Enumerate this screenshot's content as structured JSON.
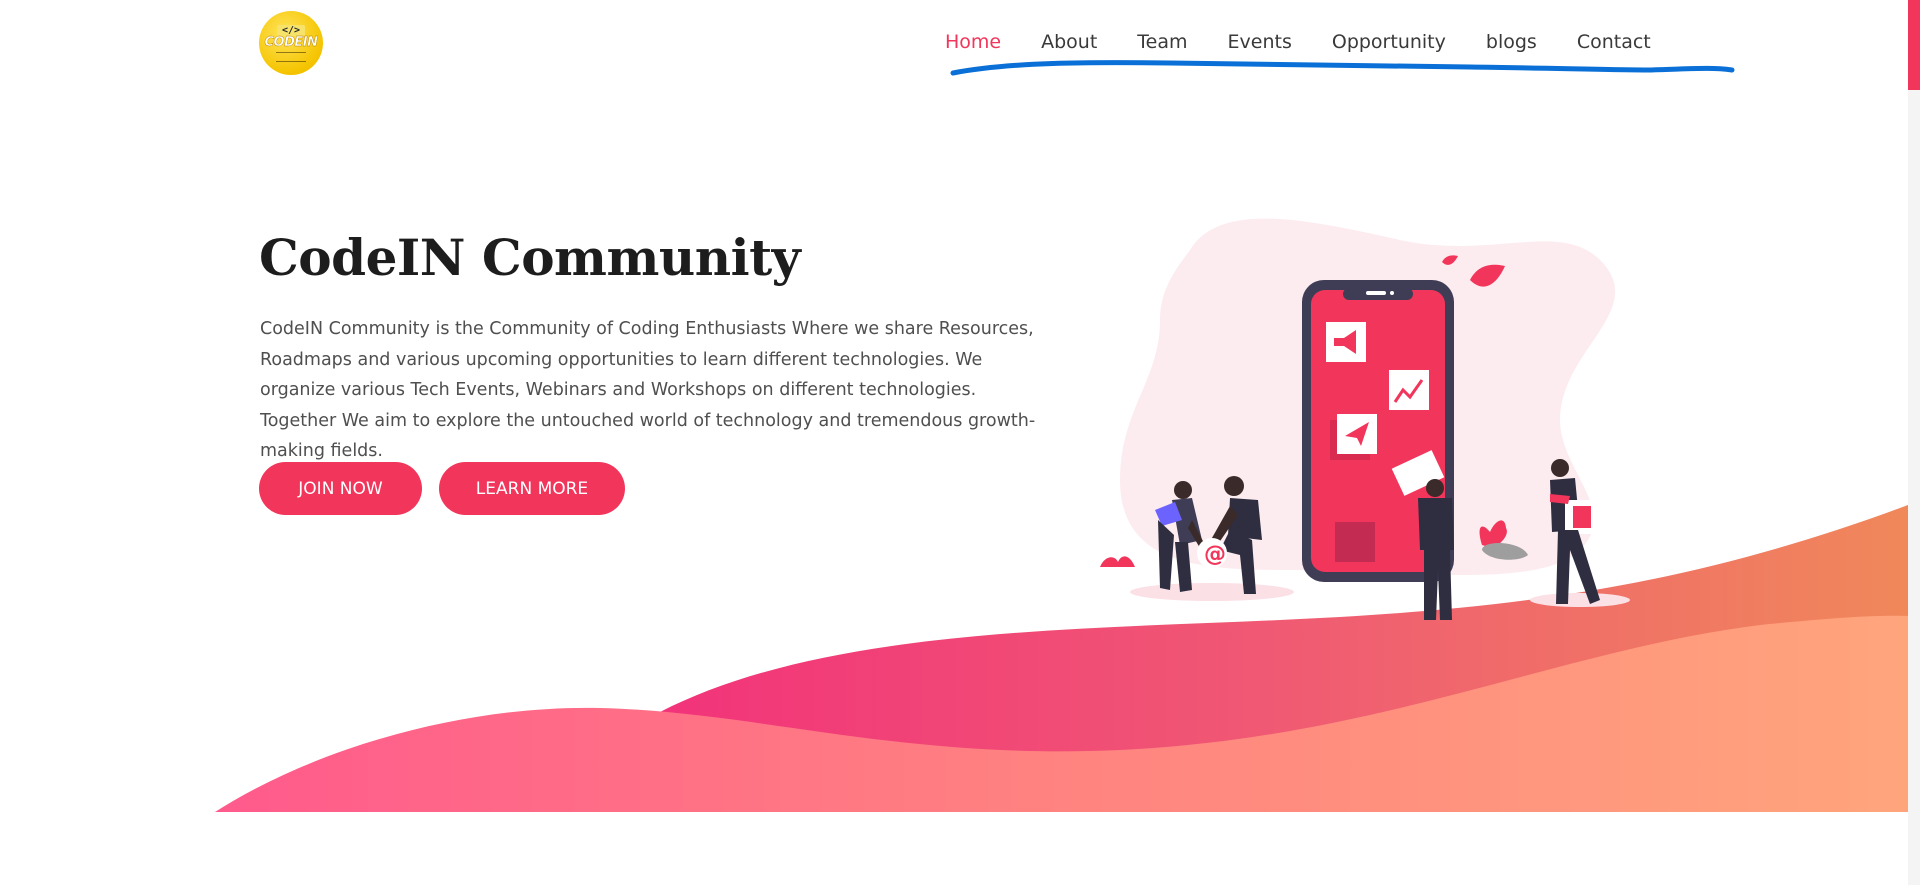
{
  "brand": {
    "logo_glyph": "</>",
    "logo_text": "CODEIN"
  },
  "nav": {
    "items": [
      {
        "label": "Home",
        "active": true
      },
      {
        "label": "About"
      },
      {
        "label": "Team"
      },
      {
        "label": "Events"
      },
      {
        "label": "Opportunity"
      },
      {
        "label": "blogs"
      },
      {
        "label": "Contact"
      }
    ]
  },
  "hero": {
    "title": "CodeIN Community",
    "description": "CodeIN Community is the Community of Coding Enthusiasts Where we share Resources, Roadmaps and various upcoming opportunities to learn different technologies. We organize various Tech Events, Webinars and Workshops on different technologies. Together We aim to explore the untouched world of technology and tremendous growth-making fields.",
    "join_button": "JOIN NOW",
    "learn_button": "LEARN MORE",
    "illustration_icons": [
      "megaphone-icon",
      "chart-icon",
      "paper-plane-icon",
      "at-sign-icon",
      "building-icon"
    ],
    "illustration_at_glyph": "@"
  },
  "colors": {
    "accent": "#f2355b",
    "nav_text": "#3a3a3a",
    "title_text": "#1d1d1d",
    "body_text": "#4f4f4f",
    "logo_yellow": "#f5c400",
    "scribble_blue": "#0a6fd6",
    "wave_pink": "#ff5c8a",
    "wave_orange": "#ffa07a",
    "phone_frame": "#3f3d56",
    "blob_pink": "#fdecef"
  }
}
